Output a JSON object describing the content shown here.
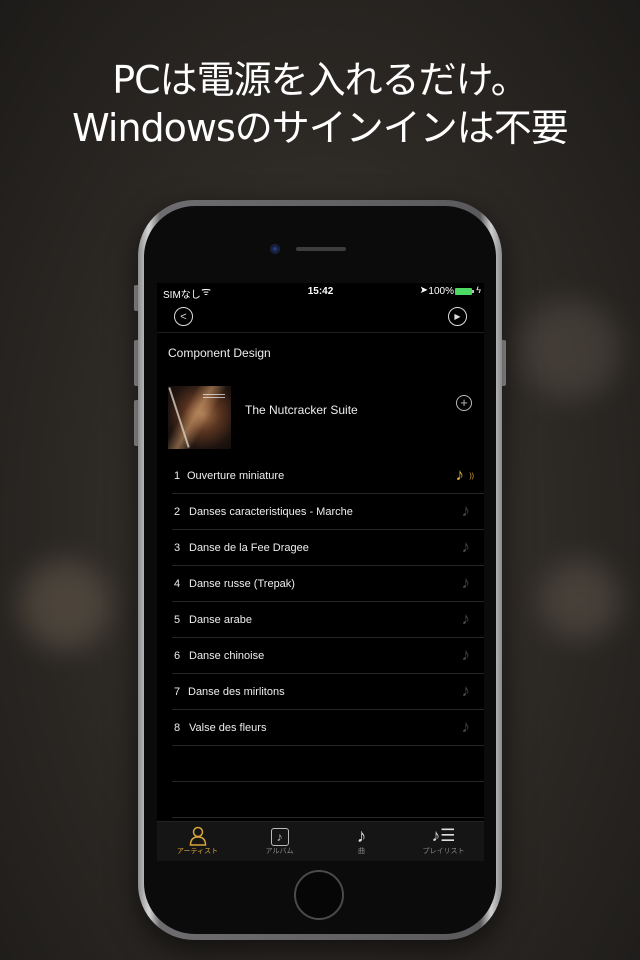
{
  "headline": {
    "line1": "PCは電源を入れるだけ。",
    "line2": "Windowsのサインインは不要"
  },
  "status_bar": {
    "carrier": "SIMなし",
    "wifi_icon": "wifi-icon",
    "time": "15:42",
    "location_icon": "location-arrow-icon",
    "battery_percent": "100%",
    "battery_level": 1.0,
    "charging_icon": "bolt-icon"
  },
  "nav": {
    "back_icon": "chevron-left-circle-icon",
    "back_glyph": "<",
    "play_icon": "play-circle-icon",
    "play_glyph": "▶"
  },
  "artist": "Component Design",
  "album": {
    "title": "The Nutcracker Suite",
    "add_glyph": "+"
  },
  "tracks": [
    {
      "num": "1",
      "title": "Ouverture miniature",
      "playing": true
    },
    {
      "num": "2",
      "title": "Danses caracteristiques - Marche",
      "playing": false
    },
    {
      "num": "3",
      "title": "Danse de la Fee Dragee",
      "playing": false
    },
    {
      "num": "4",
      "title": "Danse russe (Trepak)",
      "playing": false
    },
    {
      "num": "5",
      "title": "Danse arabe",
      "playing": false
    },
    {
      "num": "6",
      "title": "Danse chinoise",
      "playing": false
    },
    {
      "num": "7",
      "title": "Danse des mirlitons",
      "playing": false
    },
    {
      "num": "8",
      "title": "Valse des fleurs",
      "playing": false
    }
  ],
  "note_glyph": "♪",
  "wave_glyph": "))",
  "tabbar": {
    "tabs": [
      {
        "label": "アーティスト",
        "icon": "person-icon",
        "glyph": "👤",
        "active": true
      },
      {
        "label": "アルバム",
        "icon": "album-icon",
        "glyph": "♪",
        "active": false
      },
      {
        "label": "曲",
        "icon": "music-note-icon",
        "glyph": "♪",
        "active": false
      },
      {
        "label": "プレイリスト",
        "icon": "playlist-icon",
        "glyph": "♪☰",
        "active": false
      }
    ]
  },
  "colors": {
    "accent": "#e6b53a",
    "battery": "#4cd964",
    "background": "#000000"
  }
}
